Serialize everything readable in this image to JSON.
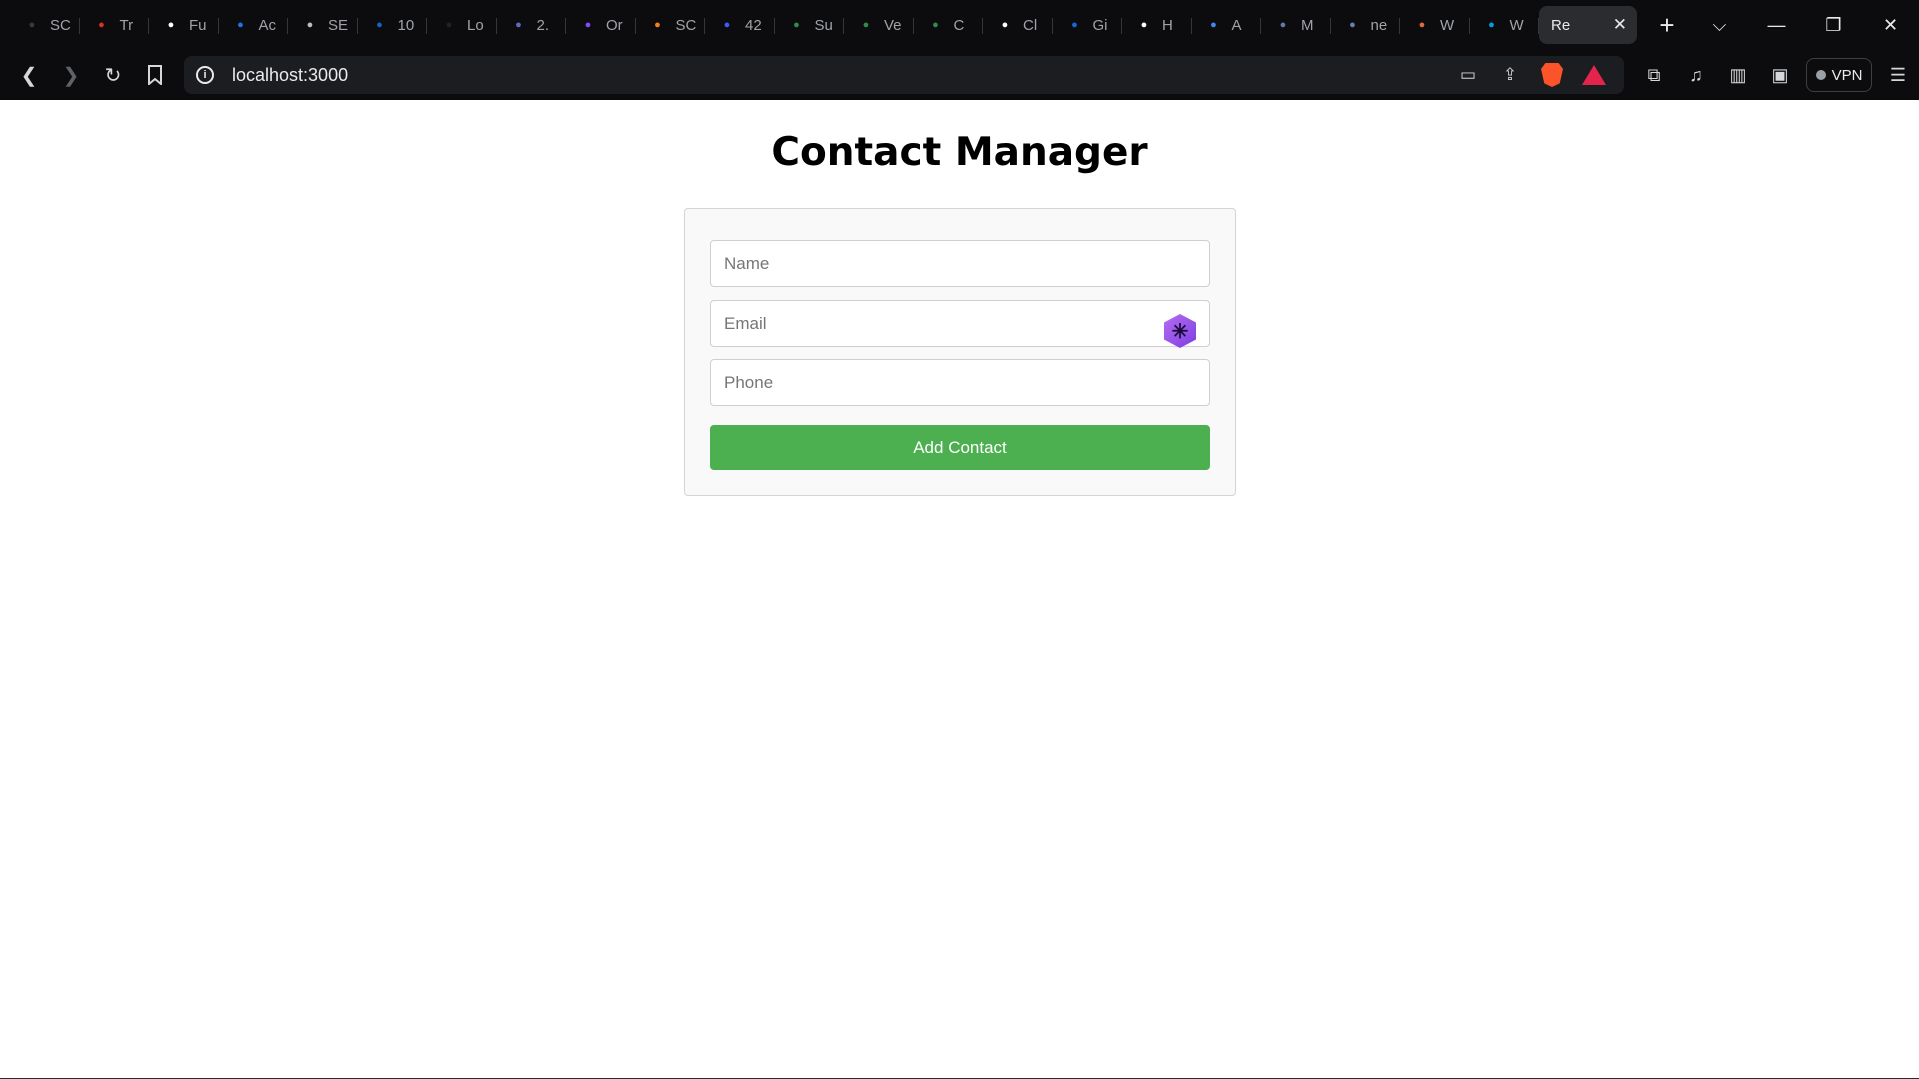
{
  "browser": {
    "tabs": [
      {
        "title": "SC",
        "icon": "page-icon",
        "color": "#3a3a3a"
      },
      {
        "title": "Tr",
        "icon": "cloud-icon",
        "color": "#d93025"
      },
      {
        "title": "Fu",
        "icon": "github-icon",
        "color": "#ffffff"
      },
      {
        "title": "Ac",
        "icon": "s-logo-icon",
        "color": "#1a73e8"
      },
      {
        "title": "SE",
        "icon": "gear-icon",
        "color": "#bdbdbd"
      },
      {
        "title": "10",
        "icon": "terminal-icon",
        "color": "#1565c0"
      },
      {
        "title": "Lo",
        "icon": "infinity-icon",
        "color": "#222222"
      },
      {
        "title": "2.",
        "icon": "cpp-icon",
        "color": "#5c6bc0"
      },
      {
        "title": "Or",
        "icon": "p-logo-icon",
        "color": "#7c4dff"
      },
      {
        "title": "SC",
        "icon": "stack-icon",
        "color": "#f48024"
      },
      {
        "title": "42",
        "icon": "code-icon",
        "color": "#3d5afe"
      },
      {
        "title": "Su",
        "icon": "gfg-icon",
        "color": "#2f8d46"
      },
      {
        "title": "Ve",
        "icon": "gfg-icon",
        "color": "#2f8d46"
      },
      {
        "title": "C",
        "icon": "gfg-icon",
        "color": "#2f8d46"
      },
      {
        "title": "Cl",
        "icon": "openai-icon",
        "color": "#ffffff"
      },
      {
        "title": "Gi",
        "icon": "confluence-icon",
        "color": "#1868db"
      },
      {
        "title": "H",
        "icon": "slash-icon",
        "color": "#ffffff"
      },
      {
        "title": "A",
        "icon": "a-logo-icon",
        "color": "#4285f4"
      },
      {
        "title": "M",
        "icon": "cross-icon",
        "color": "#5f7aa8"
      },
      {
        "title": "ne",
        "icon": "ampersand-icon",
        "color": "#6a7fb3"
      },
      {
        "title": "W",
        "icon": "dots-icon",
        "color": "#e0683a"
      },
      {
        "title": "W",
        "icon": "cloud-icon",
        "color": "#00a1e0"
      }
    ],
    "active_tab": {
      "title": "Re",
      "close": "✕"
    },
    "new_tab": "+",
    "address": "localhost:3000",
    "vpn_label": "VPN"
  },
  "app": {
    "title": "Contact Manager",
    "form": {
      "name_placeholder": "Name",
      "email_placeholder": "Email",
      "phone_placeholder": "Phone",
      "submit_label": "Add Contact"
    },
    "colors": {
      "button": "#4caf50",
      "card_bg": "#f9f9f9"
    }
  }
}
